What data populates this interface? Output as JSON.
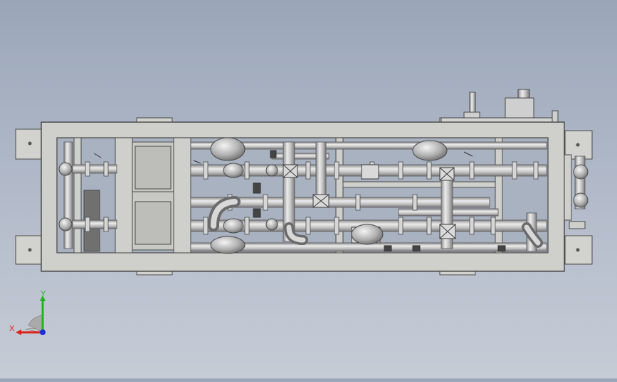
{
  "colors": {
    "background_top": "#9aa6b8",
    "background_bottom": "#c6ccd6",
    "frame_fill": "#c9c9c6",
    "frame_stroke": "#4a4a4a",
    "pipe_fill": "#bdbdbd",
    "pipe_highlight": "#e6e6e6",
    "axis_x": "#e0201b",
    "axis_y": "#1cb51c",
    "axis_z": "#1a2fd6"
  },
  "triad": {
    "x_label": "X",
    "y_label": "Y"
  },
  "icons": {
    "triad": "coordinate-triad-icon"
  }
}
